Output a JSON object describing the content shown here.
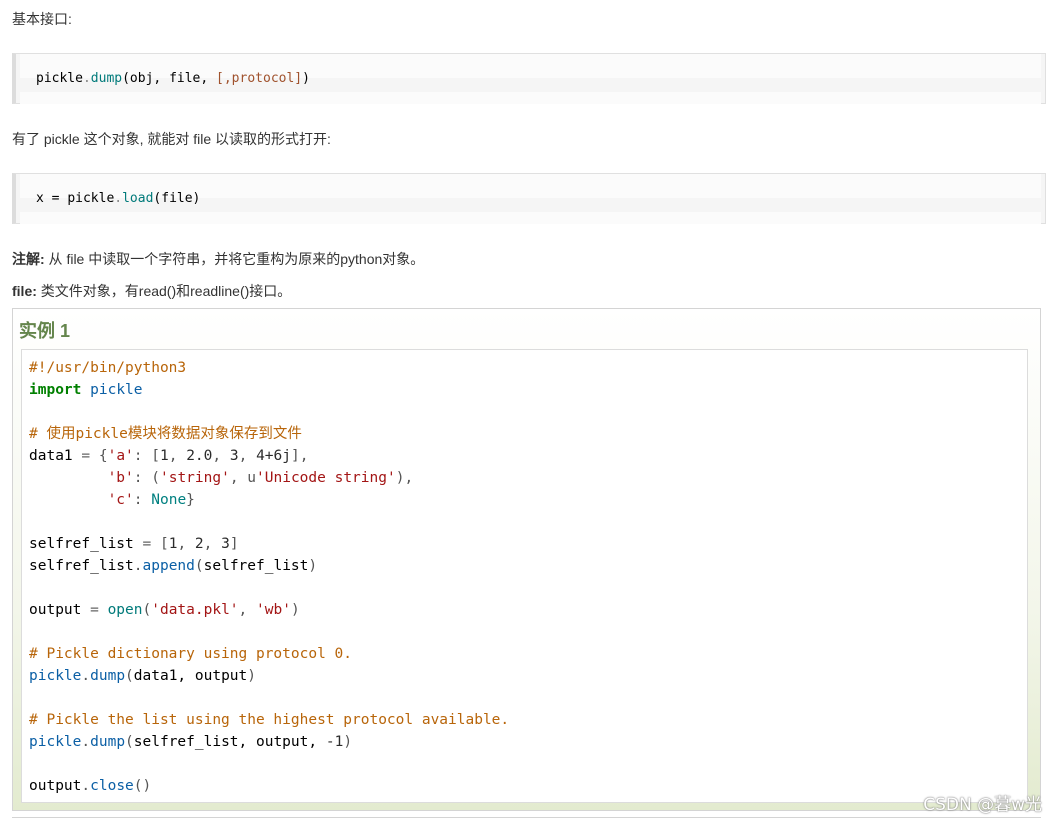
{
  "intro": {
    "text": "基本接口:"
  },
  "code1": {
    "obj": "pickle",
    "dot": ".",
    "fn": "dump",
    "args": "(obj, file, ",
    "opt": "[,protocol]",
    "close": ")"
  },
  "para2": {
    "text": "有了 pickle 这个对象, 就能对 file 以读取的形式打开:"
  },
  "code2": {
    "lhs": "x = ",
    "obj": "pickle",
    "dot": ".",
    "fn": "load",
    "args": "(file)"
  },
  "note": {
    "label": "注解:",
    "text": " 从 file 中读取一个字符串，并将它重构为原来的python对象。"
  },
  "file_note": {
    "label": "file:",
    "text": " 类文件对象，有read()和readline()接口。"
  },
  "example": {
    "title": "实例 1",
    "lines": [
      {
        "segments": [
          {
            "t": "#!/usr/bin/python3",
            "c": "com"
          }
        ]
      },
      {
        "segments": [
          {
            "t": "import",
            "c": "kw"
          },
          {
            "t": " ",
            "c": ""
          },
          {
            "t": "pickle",
            "c": "mod"
          }
        ]
      },
      {
        "segments": []
      },
      {
        "segments": [
          {
            "t": "# 使用pickle模块将数据对象保存到文件",
            "c": "com"
          }
        ]
      },
      {
        "segments": [
          {
            "t": "data1 ",
            "c": ""
          },
          {
            "t": "=",
            "c": "op"
          },
          {
            "t": " {",
            "c": "pun"
          },
          {
            "t": "'a'",
            "c": "str"
          },
          {
            "t": ": [",
            "c": "pun"
          },
          {
            "t": "1",
            "c": "num"
          },
          {
            "t": ", ",
            "c": "pun"
          },
          {
            "t": "2.0",
            "c": "num"
          },
          {
            "t": ", ",
            "c": "pun"
          },
          {
            "t": "3",
            "c": "num"
          },
          {
            "t": ", ",
            "c": "pun"
          },
          {
            "t": "4+6j",
            "c": "num"
          },
          {
            "t": "],",
            "c": "pun"
          }
        ]
      },
      {
        "segments": [
          {
            "t": "         ",
            "c": ""
          },
          {
            "t": "'b'",
            "c": "str"
          },
          {
            "t": ": (",
            "c": "pun"
          },
          {
            "t": "'string'",
            "c": "str"
          },
          {
            "t": ", u",
            "c": "pun"
          },
          {
            "t": "'Unicode string'",
            "c": "str"
          },
          {
            "t": "),",
            "c": "pun"
          }
        ]
      },
      {
        "segments": [
          {
            "t": "         ",
            "c": ""
          },
          {
            "t": "'c'",
            "c": "str"
          },
          {
            "t": ": ",
            "c": "pun"
          },
          {
            "t": "None",
            "c": "none"
          },
          {
            "t": "}",
            "c": "pun"
          }
        ]
      },
      {
        "segments": []
      },
      {
        "segments": [
          {
            "t": "selfref_list ",
            "c": ""
          },
          {
            "t": "=",
            "c": "op"
          },
          {
            "t": " [",
            "c": "pun"
          },
          {
            "t": "1",
            "c": "num"
          },
          {
            "t": ", ",
            "c": "pun"
          },
          {
            "t": "2",
            "c": "num"
          },
          {
            "t": ", ",
            "c": "pun"
          },
          {
            "t": "3",
            "c": "num"
          },
          {
            "t": "]",
            "c": "pun"
          }
        ]
      },
      {
        "segments": [
          {
            "t": "selfref_list",
            "c": ""
          },
          {
            "t": ".",
            "c": "pun"
          },
          {
            "t": "append",
            "c": "fn"
          },
          {
            "t": "(",
            "c": "pun"
          },
          {
            "t": "selfref_list",
            "c": ""
          },
          {
            "t": ")",
            "c": "pun"
          }
        ]
      },
      {
        "segments": []
      },
      {
        "segments": [
          {
            "t": "output ",
            "c": ""
          },
          {
            "t": "=",
            "c": "op"
          },
          {
            "t": " ",
            "c": ""
          },
          {
            "t": "open",
            "c": "bi"
          },
          {
            "t": "(",
            "c": "pun"
          },
          {
            "t": "'data.pkl'",
            "c": "str"
          },
          {
            "t": ", ",
            "c": "pun"
          },
          {
            "t": "'wb'",
            "c": "str"
          },
          {
            "t": ")",
            "c": "pun"
          }
        ]
      },
      {
        "segments": []
      },
      {
        "segments": [
          {
            "t": "# Pickle dictionary using protocol 0.",
            "c": "com"
          }
        ]
      },
      {
        "segments": [
          {
            "t": "pickle",
            "c": "mod"
          },
          {
            "t": ".",
            "c": "pun"
          },
          {
            "t": "dump",
            "c": "fn"
          },
          {
            "t": "(",
            "c": "pun"
          },
          {
            "t": "data1, output",
            "c": ""
          },
          {
            "t": ")",
            "c": "pun"
          }
        ]
      },
      {
        "segments": []
      },
      {
        "segments": [
          {
            "t": "# Pickle the list using the highest protocol available.",
            "c": "com"
          }
        ]
      },
      {
        "segments": [
          {
            "t": "pickle",
            "c": "mod"
          },
          {
            "t": ".",
            "c": "pun"
          },
          {
            "t": "dump",
            "c": "fn"
          },
          {
            "t": "(",
            "c": "pun"
          },
          {
            "t": "selfref_list, output, ",
            "c": ""
          },
          {
            "t": "-1",
            "c": "num"
          },
          {
            "t": ")",
            "c": "pun"
          }
        ]
      },
      {
        "segments": []
      },
      {
        "segments": [
          {
            "t": "output",
            "c": ""
          },
          {
            "t": ".",
            "c": "pun"
          },
          {
            "t": "close",
            "c": "fn"
          },
          {
            "t": "()",
            "c": "pun"
          }
        ]
      }
    ]
  },
  "watermark": {
    "text": "CSDN @暮w光"
  }
}
